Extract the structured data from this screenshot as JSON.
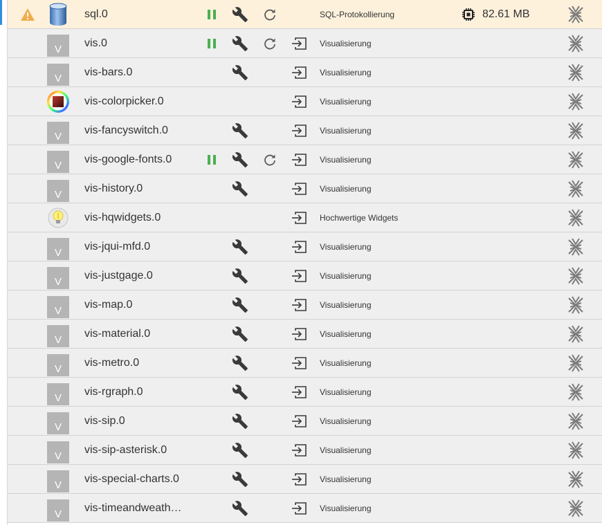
{
  "colors": {
    "warning_row_bg": "#fdf1dc",
    "row_bg": "#efefef",
    "running_green": "#4caf50",
    "icon_dark": "#3a3a3a",
    "warning_orange": "#f0ad4e",
    "logo_gray": "#b5b5b5"
  },
  "instances": [
    {
      "name": "sql.0",
      "description": "SQL-Protokollierung",
      "logo": "database-logo",
      "warning": true,
      "running": true,
      "settings": true,
      "restart": true,
      "link": false,
      "memory": "82.61 MB"
    },
    {
      "name": "vis.0",
      "description": "Visualisierung",
      "logo": "v-logo",
      "logo_letter": "V",
      "running": true,
      "settings": true,
      "restart": true,
      "link": true
    },
    {
      "name": "vis-bars.0",
      "description": "Visualisierung",
      "logo": "v-logo",
      "logo_letter": "V",
      "settings": true,
      "link": true
    },
    {
      "name": "vis-colorpicker.0",
      "description": "Visualisierung",
      "logo": "colorpicker-logo",
      "link": true
    },
    {
      "name": "vis-fancyswitch.0",
      "description": "Visualisierung",
      "logo": "v-logo",
      "logo_letter": "V",
      "settings": true,
      "link": true
    },
    {
      "name": "vis-google-fonts.0",
      "description": "Visualisierung",
      "logo": "v-logo",
      "logo_letter": "V",
      "running": true,
      "settings": true,
      "restart": true,
      "link": true
    },
    {
      "name": "vis-history.0",
      "description": "Visualisierung",
      "logo": "v-logo",
      "logo_letter": "V",
      "settings": true,
      "link": true
    },
    {
      "name": "vis-hqwidgets.0",
      "description": "Hochwertige Widgets",
      "logo": "bulb-logo",
      "link": true
    },
    {
      "name": "vis-jqui-mfd.0",
      "description": "Visualisierung",
      "logo": "v-logo",
      "logo_letter": "V",
      "settings": true,
      "link": true
    },
    {
      "name": "vis-justgage.0",
      "description": "Visualisierung",
      "logo": "v-logo",
      "logo_letter": "V",
      "settings": true,
      "link": true
    },
    {
      "name": "vis-map.0",
      "description": "Visualisierung",
      "logo": "v-logo",
      "logo_letter": "V",
      "settings": true,
      "link": true
    },
    {
      "name": "vis-material.0",
      "description": "Visualisierung",
      "logo": "v-logo",
      "logo_letter": "V",
      "settings": true,
      "link": true
    },
    {
      "name": "vis-metro.0",
      "description": "Visualisierung",
      "logo": "v-logo",
      "logo_letter": "V",
      "settings": true,
      "link": true
    },
    {
      "name": "vis-rgraph.0",
      "description": "Visualisierung",
      "logo": "v-logo",
      "logo_letter": "V",
      "settings": true,
      "link": true
    },
    {
      "name": "vis-sip.0",
      "description": "Visualisierung",
      "logo": "v-logo",
      "logo_letter": "V",
      "settings": true,
      "link": true
    },
    {
      "name": "vis-sip-asterisk.0",
      "description": "Visualisierung",
      "logo": "v-logo",
      "logo_letter": "V",
      "settings": true,
      "link": true
    },
    {
      "name": "vis-special-charts.0",
      "description": "Visualisierung",
      "logo": "v-logo",
      "logo_letter": "V",
      "settings": true,
      "link": true
    },
    {
      "name": "vis-timeandweath…",
      "description": "Visualisierung",
      "logo": "v-logo",
      "logo_letter": "V",
      "settings": true,
      "link": true
    }
  ]
}
